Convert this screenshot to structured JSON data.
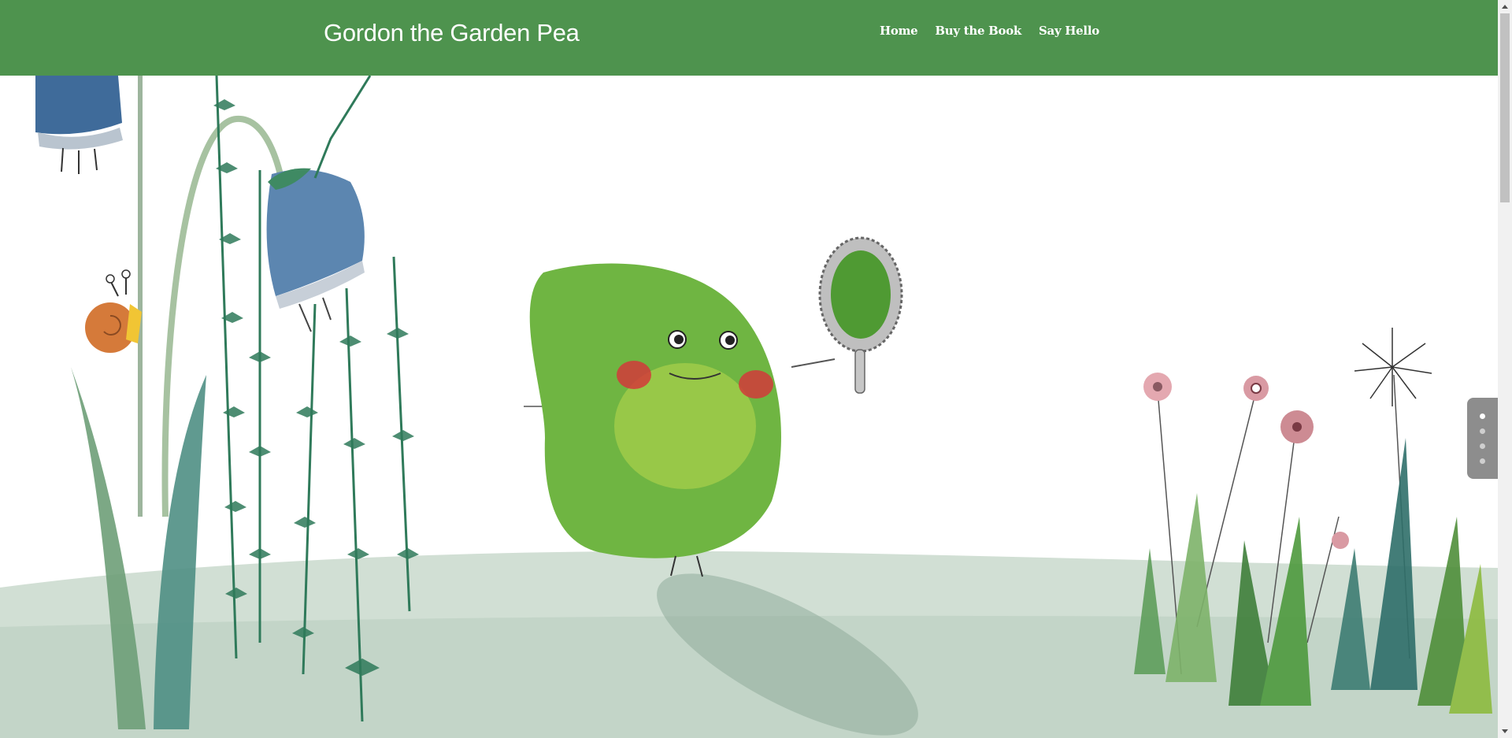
{
  "header": {
    "site_title": "Gordon the Garden Pea",
    "nav": [
      {
        "label": "Home"
      },
      {
        "label": "Buy the Book"
      },
      {
        "label": "Say Hello"
      }
    ],
    "colors": {
      "header_bg": "#4e934e",
      "text": "#ffffff"
    }
  },
  "hero": {
    "illustration": "watercolor-garden-with-pea-character",
    "slider": {
      "total_slides": 4,
      "active_index": 0
    }
  },
  "scrollbar": {
    "icon_up": "triangle-up-icon",
    "icon_down": "triangle-down-icon"
  }
}
